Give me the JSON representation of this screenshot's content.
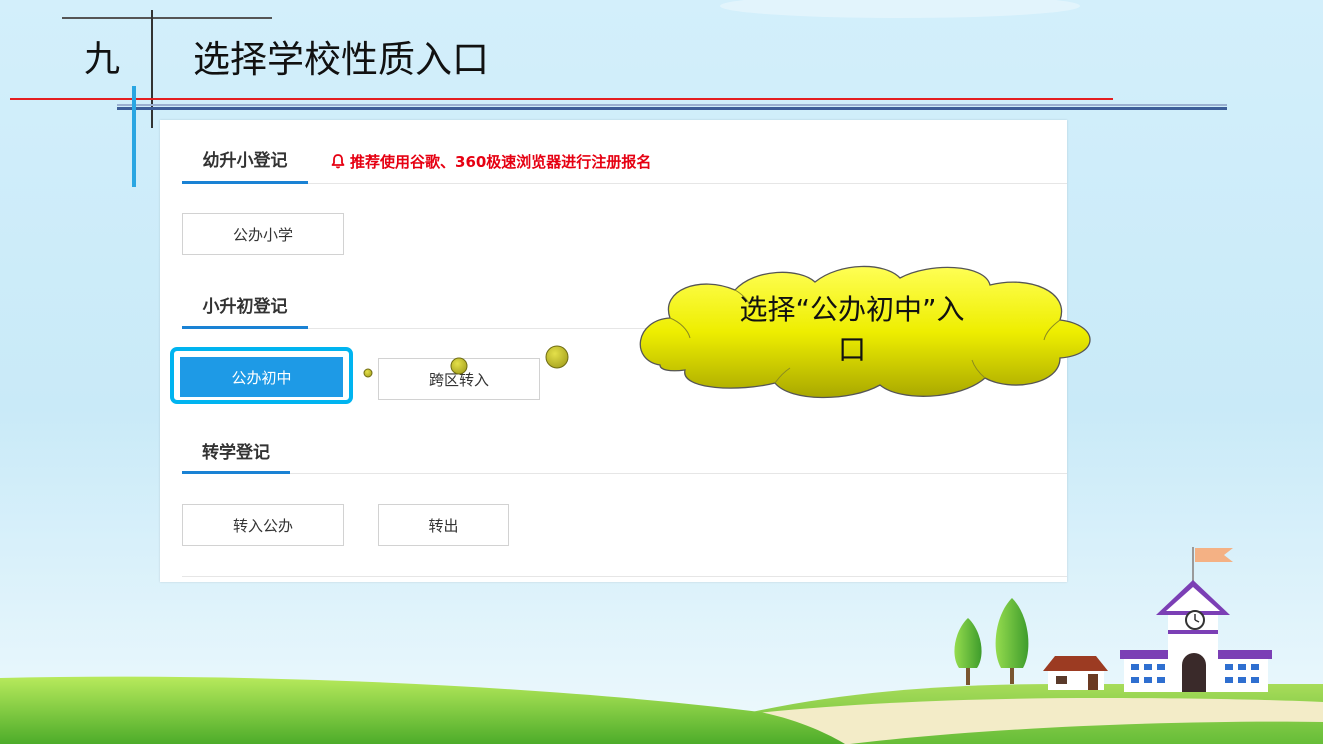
{
  "slide": {
    "number": "九",
    "title": "选择学校性质入口"
  },
  "panel": {
    "notice": {
      "icon": "bell-icon",
      "text": "推荐使用谷歌、360极速浏览器进行注册报名"
    },
    "sections": [
      {
        "title": "幼升小登记",
        "buttons": [
          {
            "label": "公办小学",
            "primary": false,
            "highlighted": false
          }
        ]
      },
      {
        "title": "小升初登记",
        "buttons": [
          {
            "label": "公办初中",
            "primary": true,
            "highlighted": true
          },
          {
            "label": "跨区转入",
            "primary": false,
            "highlighted": false
          }
        ]
      },
      {
        "title": "转学登记",
        "buttons": [
          {
            "label": "转入公办",
            "primary": false,
            "highlighted": false
          },
          {
            "label": "转出",
            "primary": false,
            "highlighted": false
          }
        ]
      }
    ]
  },
  "callout": {
    "lines": [
      "选择“公办初中”入",
      "口"
    ]
  },
  "colors": {
    "accent_blue": "#1e9ae6",
    "tab_underline": "#1a82d4",
    "notice_red": "#e60012",
    "highlight_cyan": "#00b4f0",
    "callout_yellow": "#f0f000",
    "header_red_rule": "#e41e20",
    "header_blue_rule": "#3d5e98"
  }
}
